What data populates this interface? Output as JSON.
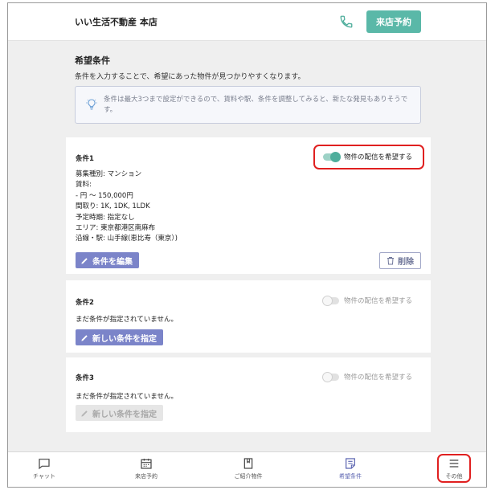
{
  "header": {
    "shop_name": "いい生活不動産 本店",
    "reserve_label": "来店予約"
  },
  "intro": {
    "title": "希望条件",
    "description": "条件を入力することで、希望にあった物件が見つかりやすくなります。",
    "hint": "条件は最大3つまで設定ができるので、賃料や駅、条件を調整してみると、新たな発見もありそうです。"
  },
  "conditions": [
    {
      "title": "条件1",
      "toggle_label": "物件の配信を希望する",
      "toggle_on": true,
      "lines": [
        "募集種別: マンション",
        "賃料:",
        "- 円 ～ 150,000円",
        "間取り: 1K, 1DK, 1LDK",
        "予定時期: 指定なし",
        "エリア: 東京都港区南麻布",
        "沿線・駅: 山手線(恵比寿（東京）)"
      ],
      "edit_label": "条件を編集",
      "delete_label": "削除"
    },
    {
      "title": "条件2",
      "toggle_label": "物件の配信を希望する",
      "toggle_on": false,
      "empty_text": "まだ条件が指定されていません。",
      "new_label": "新しい条件を指定"
    },
    {
      "title": "条件3",
      "toggle_label": "物件の配信を希望する",
      "toggle_on": false,
      "empty_text": "まだ条件が指定されていません。",
      "new_label": "新しい条件を指定"
    }
  ],
  "bottom_nav": [
    {
      "label": "チャット",
      "icon": "chat-icon"
    },
    {
      "label": "来店予約",
      "icon": "calendar-icon"
    },
    {
      "label": "ご紹介物件",
      "icon": "bookmark-icon"
    },
    {
      "label": "希望条件",
      "icon": "document-icon",
      "active": true
    },
    {
      "label": "その他",
      "icon": "menu-icon"
    }
  ],
  "colors": {
    "accent_teal": "#5ab8a8",
    "primary_button": "#7b84c9",
    "highlight_red": "#e02020"
  }
}
